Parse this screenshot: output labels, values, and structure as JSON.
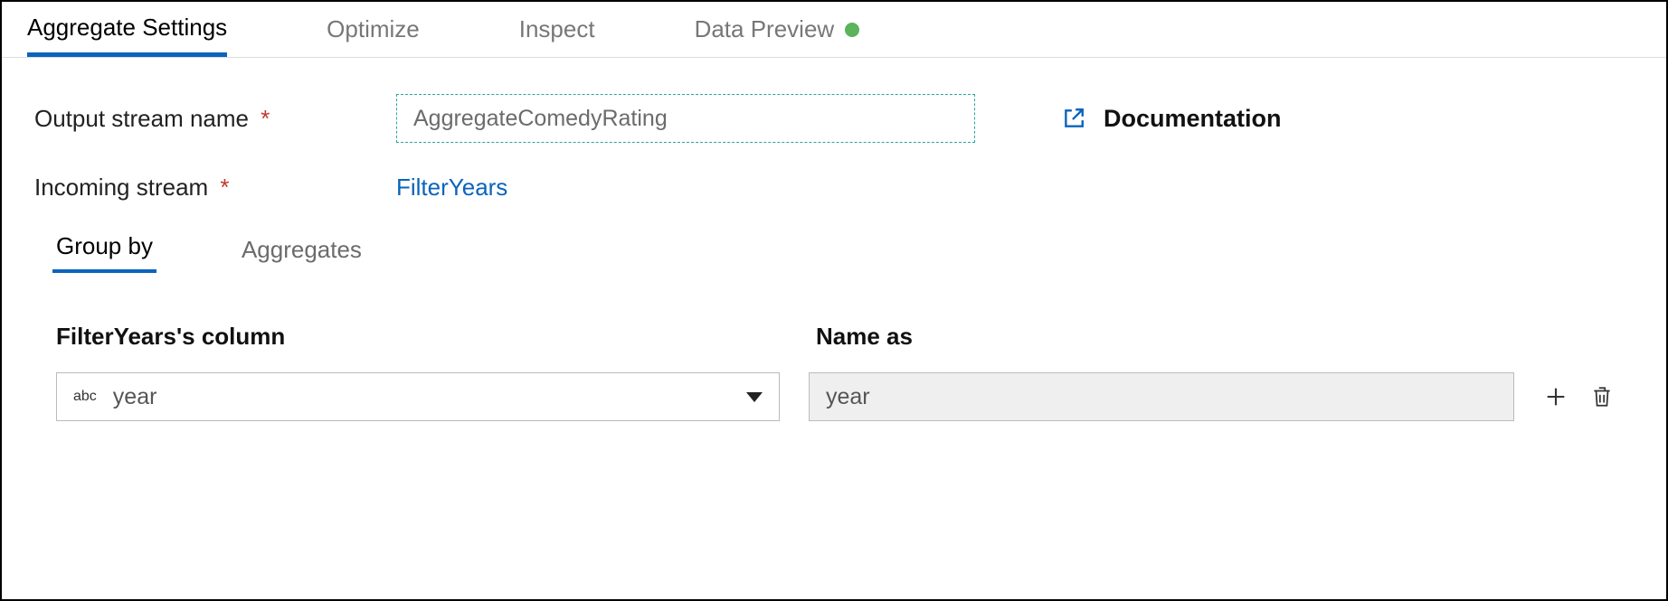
{
  "tabs": {
    "aggregate_settings": "Aggregate Settings",
    "optimize": "Optimize",
    "inspect": "Inspect",
    "data_preview": "Data Preview"
  },
  "fields": {
    "output_stream_label": "Output stream name",
    "output_stream_value": "AggregateComedyRating",
    "incoming_stream_label": "Incoming stream",
    "incoming_stream_value": "FilterYears"
  },
  "doc_link_label": "Documentation",
  "subtabs": {
    "group_by": "Group by",
    "aggregates": "Aggregates"
  },
  "columns": {
    "source_label": "FilterYears's column",
    "name_as_label": "Name as"
  },
  "row": {
    "dtype": "abc",
    "column_value": "year",
    "name_as_value": "year"
  }
}
